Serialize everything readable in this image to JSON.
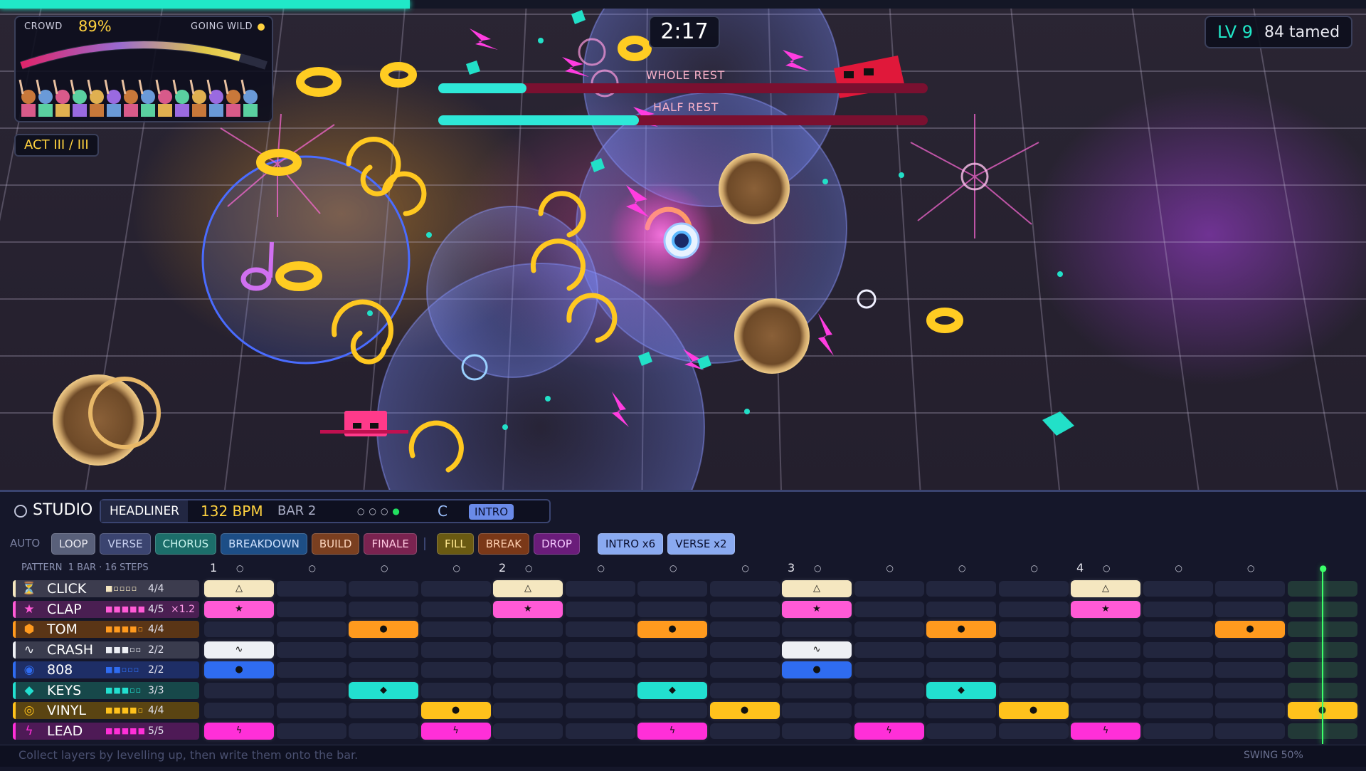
{
  "hud": {
    "crowd_label": "CROWD",
    "crowd_percent": "89%",
    "crowd_level": 0.89,
    "crowd_status": "GOING WILD",
    "act": "ACT III / III",
    "timer": "2:17",
    "level": "LV 9",
    "tamed": "84 tamed",
    "xp_progress": 0.3
  },
  "bosses": [
    {
      "name": "WHOLE REST",
      "health": 0.18
    },
    {
      "name": "HALF REST",
      "health": 0.41
    }
  ],
  "studio": {
    "title": "STUDIO",
    "rank": "HEADLINER",
    "bpm": "132 BPM",
    "bar": "BAR 2",
    "key": "C",
    "section": "INTRO",
    "auto_label": "AUTO",
    "arrangement_buttons": [
      {
        "label": "LOOP",
        "color": "#59607a",
        "text": "#e8e8f0"
      },
      {
        "label": "VERSE",
        "color": "#3b4470",
        "text": "#c8d0f0"
      },
      {
        "label": "CHORUS",
        "color": "#1c6e6a",
        "text": "#c8f5ee"
      },
      {
        "label": "BREAKDOWN",
        "color": "#1d4e86",
        "text": "#cfe2ff"
      },
      {
        "label": "BUILD",
        "color": "#7a3f20",
        "text": "#ffd8c0"
      },
      {
        "label": "FINALE",
        "color": "#7a2350",
        "text": "#ffc8e0"
      }
    ],
    "fx_buttons": [
      {
        "label": "FILL",
        "color": "#6a5a12",
        "text": "#ffe890"
      },
      {
        "label": "BREAK",
        "color": "#7a3818",
        "text": "#ffd0b0"
      },
      {
        "label": "DROP",
        "color": "#6a1c7a",
        "text": "#f5c8ff"
      }
    ],
    "queue": [
      {
        "label": "INTRO x6"
      },
      {
        "label": "VERSE x2"
      }
    ],
    "pattern_info": "PATTERN  1 BAR · 16 STEPS",
    "beat_numbers": [
      "1",
      "2",
      "3",
      "4"
    ],
    "playhead_step": 16,
    "tracks": [
      {
        "name": "CLICK",
        "icon": "metronome-icon",
        "glyph": "⏳",
        "count": "4/4",
        "mult": "",
        "color": "#f5e7c0",
        "label_bg": "#3c3c4e",
        "dots": "■▫▫▫▫",
        "steps": [
          1,
          5,
          9,
          13
        ],
        "note_glyph": "△"
      },
      {
        "name": "CLAP",
        "icon": "star-icon",
        "glyph": "★",
        "count": "4/5",
        "mult": "×1.2",
        "color": "#ff5ad6",
        "label_bg": "#4a1f52",
        "dots": "■■■■■",
        "steps": [
          1,
          5,
          9,
          13
        ],
        "note_glyph": "★"
      },
      {
        "name": "TOM",
        "icon": "hexagon-icon",
        "glyph": "⬢",
        "count": "4/4",
        "mult": "",
        "color": "#ff9a1e",
        "label_bg": "#5a3516",
        "dots": "■■■■▫",
        "steps": [
          3,
          7,
          11,
          15
        ],
        "note_glyph": "●"
      },
      {
        "name": "CRASH",
        "icon": "wave-icon",
        "glyph": "∿",
        "count": "2/2",
        "mult": "",
        "color": "#eef0f5",
        "label_bg": "#3a3c4e",
        "dots": "■■■▫▫",
        "steps": [
          1,
          9
        ],
        "note_glyph": "∿"
      },
      {
        "name": "808",
        "icon": "target-icon",
        "glyph": "◉",
        "count": "2/2",
        "mult": "",
        "color": "#2f6cf0",
        "label_bg": "#1e2e66",
        "dots": "■■▫▫▫",
        "steps": [
          1,
          9
        ],
        "note_glyph": "●"
      },
      {
        "name": "KEYS",
        "icon": "diamond-icon",
        "glyph": "◆",
        "count": "3/3",
        "mult": "",
        "color": "#22e0d0",
        "label_bg": "#17484a",
        "dots": "■■■▫▫",
        "steps": [
          3,
          7,
          11
        ],
        "note_glyph": "◆"
      },
      {
        "name": "VINYL",
        "icon": "record-icon",
        "glyph": "◎",
        "count": "4/4",
        "mult": "",
        "color": "#ffc21c",
        "label_bg": "#5a4412",
        "dots": "■■■■▫",
        "steps": [
          4,
          8,
          12,
          16
        ],
        "note_glyph": "●"
      },
      {
        "name": "LEAD",
        "icon": "lightning-icon",
        "glyph": "ϟ",
        "count": "5/5",
        "mult": "",
        "color": "#ff2fd8",
        "label_bg": "#4e1a56",
        "dots": "■■■■■",
        "steps": [
          1,
          4,
          7,
          10,
          13
        ],
        "note_glyph": "ϟ"
      }
    ],
    "hint": "Collect layers by levelling up, then write them onto the bar.",
    "swing": "SWING 50%"
  }
}
